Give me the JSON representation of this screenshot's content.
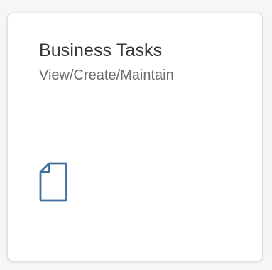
{
  "tile": {
    "title": "Business Tasks",
    "subtitle": "View/Create/Maintain",
    "icon": "document-icon",
    "icon_color": "#43709a"
  }
}
